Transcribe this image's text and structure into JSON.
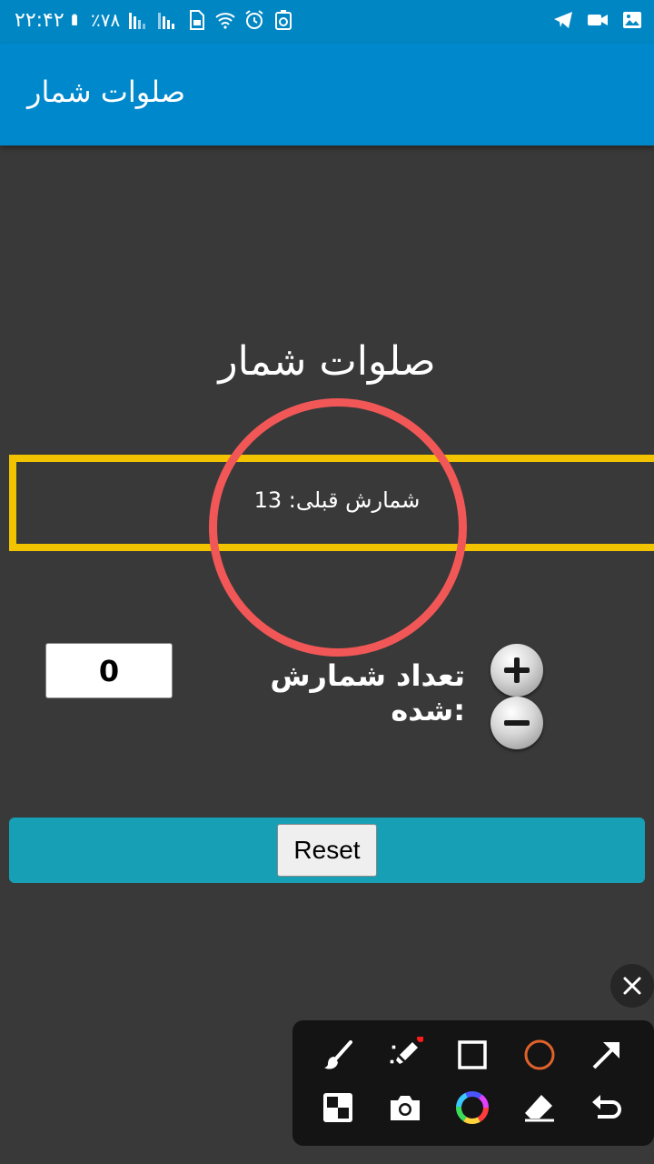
{
  "status_bar": {
    "time": "۲۲:۴۲",
    "battery": "٪۷۸",
    "icons": [
      "battery-icon",
      "signal-icon",
      "signal-icon",
      "sim-icon",
      "wifi-icon",
      "alarm-icon",
      "recycle-icon",
      "telegram-icon",
      "video-icon",
      "image-icon"
    ]
  },
  "app_bar": {
    "title": "صلوات شمار"
  },
  "main": {
    "heading": "صلوات شمار",
    "previous_count": "شمارش قبلی: 13",
    "count_label": "تعداد شمارش شده:",
    "count_value": "0",
    "plus_icon": "plus-icon",
    "minus_icon": "minus-icon",
    "reset_label": "Reset"
  },
  "overlay_toolbar": {
    "tools": [
      "brush-icon",
      "magic-marker-icon",
      "rectangle-icon",
      "circle-icon",
      "arrow-icon",
      "mosaic-icon",
      "camera-icon",
      "color-wheel-icon",
      "eraser-icon",
      "undo-icon"
    ],
    "close_icon": "close-icon",
    "accent_colors": {
      "circle": "#e0622a",
      "dot": "#ff1a1a"
    }
  },
  "colors": {
    "app_bar": "#0088cc",
    "background": "#393939",
    "highlight_box": "#f2c400",
    "annotation_circle": "#f25757",
    "reset_bar": "#179fb5"
  }
}
